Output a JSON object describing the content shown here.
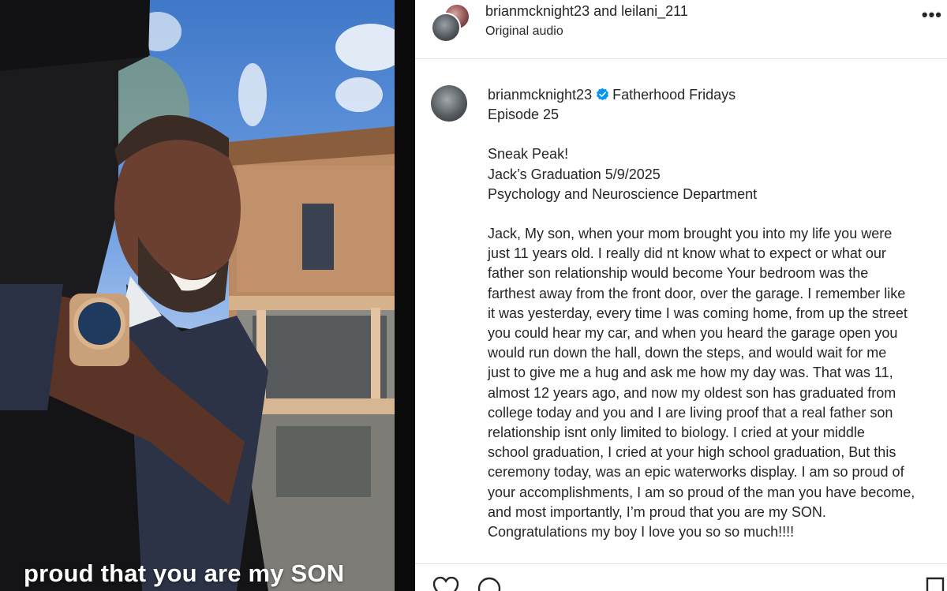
{
  "media": {
    "overlay_caption": "proud that you are my SON"
  },
  "post": {
    "header": {
      "names": "brianmcknight23 and leilani_211",
      "audio": "Original audio",
      "more_icon": "more-horizontal-icon"
    },
    "caption": {
      "username": "brianmcknight23",
      "verified_icon": "verified-badge-icon",
      "title": "Fatherhood Fridays",
      "lines_intro": [
        "Episode 25"
      ],
      "lines_block1": [
        "Sneak Peak!",
        "Jack’s Graduation 5/9/2025",
        "Psychology and Neuroscience Department"
      ],
      "lines_body": [
        "Jack, My son, when your mom brought you into my life you were",
        "just 11 years old. I really did nt know what to expect or what our",
        "father son relationship would become Your bedroom was the",
        "farthest away from the front door, over the garage. I remember like",
        "it was yesterday, every time I was coming home, from up the street",
        "you could hear my car, and when you heard the garage open you",
        "would run down the hall, down the steps, and would wait for me",
        "just to give me a hug and ask me how my day was. That was 11,",
        "almost 12 years ago, and now my oldest son has graduated from",
        "college today and you and I are living proof that a real father son",
        "relationship isnt only limited to biology. I cried at your middle",
        "school graduation, I cried at your high school graduation, But this",
        "ceremony today, was an epic waterworks display. I am so proud of",
        "your accomplishments, I am so proud of the man you have become,",
        "and most importantly, I’m proud that you are my SON.",
        "Congratulations my boy I love you so so much!!!!"
      ]
    },
    "actions": {
      "like_icon": "heart-icon",
      "comment_icon": "comment-icon",
      "save_icon": "bookmark-icon"
    }
  },
  "colors": {
    "text": "#262626",
    "verified": "#0095f6",
    "divider": "#e2e2e2"
  }
}
